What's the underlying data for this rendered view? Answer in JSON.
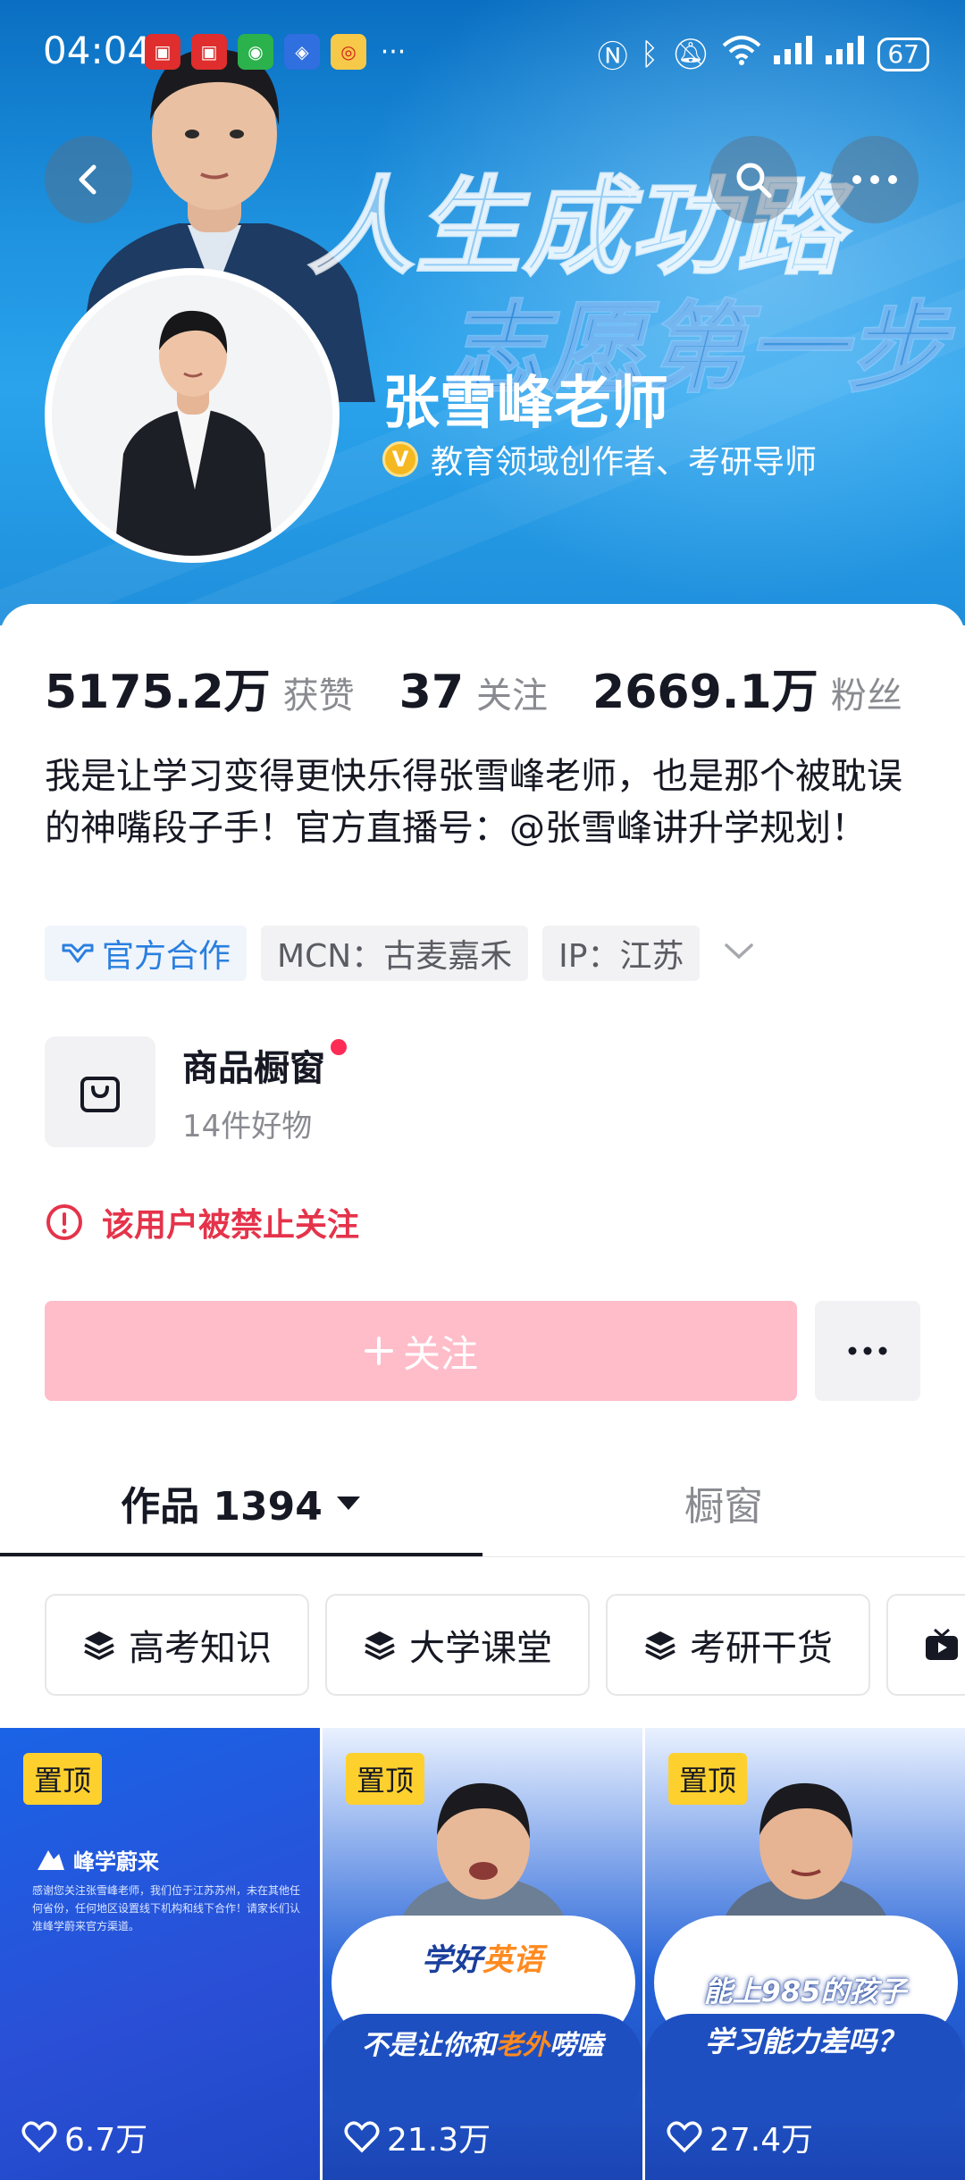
{
  "status_bar": {
    "time": "04:04",
    "battery": "67"
  },
  "banner": {
    "slogan_line1": "人生成功路",
    "slogan_line2": "志愿第一步"
  },
  "profile": {
    "name": "张雪峰老师",
    "verification": "教育领域创作者、考研导师",
    "stats": [
      {
        "value": "5175.2万",
        "label": "获赞"
      },
      {
        "value": "37",
        "label": "关注"
      },
      {
        "value": "2669.1万",
        "label": "粉丝"
      }
    ],
    "bio": "我是让学习变得更快乐得张雪峰老师，也是那个被耽误的神嘴段子手！官方直播号：@张雪峰讲升学规划！",
    "tags": {
      "official": "官方合作",
      "mcn": "MCN：古麦嘉禾",
      "ip": "IP：江苏"
    }
  },
  "shop": {
    "title": "商品橱窗",
    "subtitle": "14件好物"
  },
  "banned_notice": "该用户被禁止关注",
  "actions": {
    "follow_label": "关注"
  },
  "tabs": {
    "works": "作品 1394",
    "showcase": "橱窗"
  },
  "collections": [
    "高考知识",
    "大学课堂",
    "考研干货"
  ],
  "videos": [
    {
      "pin": "置顶",
      "likes": "6.7万",
      "brand": "峰学蔚来",
      "notice": "感谢您关注张雪峰老师，我们位于江苏苏州，未在其他任何省份，任何地区设置线下机构和线下合作！请家长们认准峰学蔚来官方渠道。"
    },
    {
      "pin": "置顶",
      "likes": "21.3万",
      "caption_line1": "学好",
      "caption_hl1": "英语",
      "caption_line2a": "不是让你和",
      "caption_hl2": "老外",
      "caption_line2b": "唠嗑"
    },
    {
      "pin": "置顶",
      "likes": "27.4万",
      "caption_line1": "能上985的孩子",
      "caption_line2": "学习能力差吗？"
    }
  ],
  "colors": {
    "accent": "#fe2c55",
    "follow_disabled": "#ffbcc9",
    "banned_text": "#e5334b",
    "pin_bg": "#fdd02e",
    "link_blue": "#2a7fe0"
  }
}
